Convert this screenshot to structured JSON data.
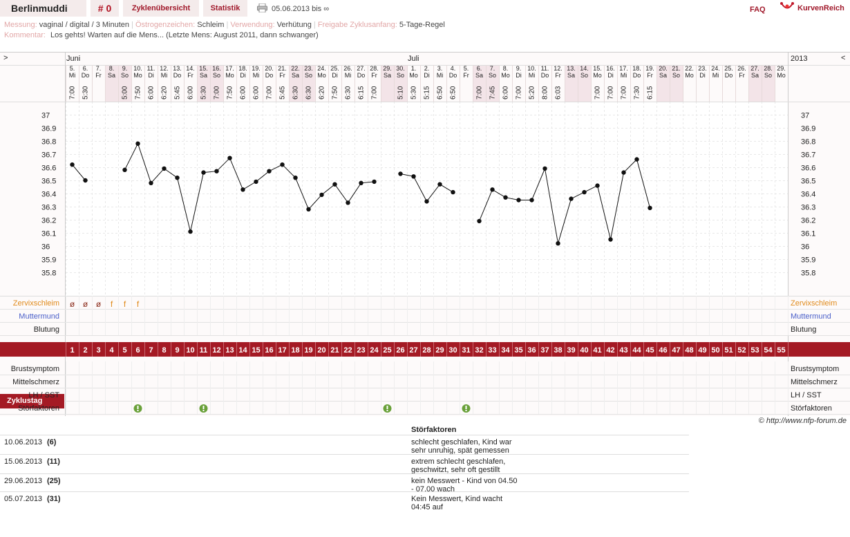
{
  "header": {
    "username": "Berlinmuddi",
    "cycle_number": "# 0",
    "tabs": [
      "Zyklenübersicht",
      "Statistik"
    ],
    "date_range": "05.06.2013 bis ∞",
    "faq": "FAQ",
    "brand": "KurvenReich"
  },
  "info": {
    "messung_label": "Messung:",
    "messung_value": "vaginal / digital / 3 Minuten",
    "oestrogen_label": "Östrogenzeichen:",
    "oestrogen_value": "Schleim",
    "verwendung_label": "Verwendung:",
    "verwendung_value": "Verhütung",
    "freigabe_label": "Freigabe Zyklusanfang:",
    "freigabe_value": "5-Tage-Regel",
    "kommentar_label": "Kommentar:",
    "kommentar_value": "Los gehts! Warten auf die Mens...  (Letzte Mens: August 2011, dann schwanger)"
  },
  "chart_nav": {
    "left_arrow": ">",
    "right_arrow": "<",
    "year": "2013"
  },
  "months": [
    {
      "day_index": 0,
      "label": "Juni"
    },
    {
      "day_index": 26,
      "label": "Juli"
    }
  ],
  "days": [
    {
      "d": "5.",
      "w": "Mi",
      "t": "7:00"
    },
    {
      "d": "6.",
      "w": "Do",
      "t": "5:30"
    },
    {
      "d": "7.",
      "w": "Fr",
      "t": ""
    },
    {
      "d": "8.",
      "w": "Sa",
      "t": ""
    },
    {
      "d": "9.",
      "w": "So",
      "t": "5:00"
    },
    {
      "d": "10.",
      "w": "Mo",
      "t": "7:50"
    },
    {
      "d": "11.",
      "w": "Di",
      "t": "6:00"
    },
    {
      "d": "12.",
      "w": "Mi",
      "t": "6:20"
    },
    {
      "d": "13.",
      "w": "Do",
      "t": "5:45"
    },
    {
      "d": "14.",
      "w": "Fr",
      "t": "6:00"
    },
    {
      "d": "15.",
      "w": "Sa",
      "t": "5:30"
    },
    {
      "d": "16.",
      "w": "So",
      "t": "7:00"
    },
    {
      "d": "17.",
      "w": "Mo",
      "t": "7:50"
    },
    {
      "d": "18.",
      "w": "Di",
      "t": "6:00"
    },
    {
      "d": "19.",
      "w": "Mi",
      "t": "6:00"
    },
    {
      "d": "20.",
      "w": "Do",
      "t": "7:00"
    },
    {
      "d": "21.",
      "w": "Fr",
      "t": "5:45"
    },
    {
      "d": "22.",
      "w": "Sa",
      "t": "6:30"
    },
    {
      "d": "23.",
      "w": "So",
      "t": "6:30"
    },
    {
      "d": "24.",
      "w": "Mo",
      "t": "6:20"
    },
    {
      "d": "25.",
      "w": "Di",
      "t": "7:50"
    },
    {
      "d": "26.",
      "w": "Mi",
      "t": "6:30"
    },
    {
      "d": "27.",
      "w": "Do",
      "t": "6:15"
    },
    {
      "d": "28.",
      "w": "Fr",
      "t": "7:00"
    },
    {
      "d": "29.",
      "w": "Sa",
      "t": ""
    },
    {
      "d": "30.",
      "w": "So",
      "t": "5:10"
    },
    {
      "d": "1.",
      "w": "Mo",
      "t": "5:30"
    },
    {
      "d": "2.",
      "w": "Di",
      "t": "5:15"
    },
    {
      "d": "3.",
      "w": "Mi",
      "t": "6:50"
    },
    {
      "d": "4.",
      "w": "Do",
      "t": "6:50"
    },
    {
      "d": "5.",
      "w": "Fr",
      "t": ""
    },
    {
      "d": "6.",
      "w": "Sa",
      "t": "7:00"
    },
    {
      "d": "7.",
      "w": "So",
      "t": "7:45"
    },
    {
      "d": "8.",
      "w": "Mo",
      "t": "6:00"
    },
    {
      "d": "9.",
      "w": "Di",
      "t": "7:00"
    },
    {
      "d": "10.",
      "w": "Mi",
      "t": "5:20"
    },
    {
      "d": "11.",
      "w": "Do",
      "t": "8:00"
    },
    {
      "d": "12.",
      "w": "Fr",
      "t": "6:03"
    },
    {
      "d": "13.",
      "w": "Sa",
      "t": ""
    },
    {
      "d": "14.",
      "w": "So",
      "t": ""
    },
    {
      "d": "15.",
      "w": "Mo",
      "t": "7:00"
    },
    {
      "d": "16.",
      "w": "Di",
      "t": "7:00"
    },
    {
      "d": "17.",
      "w": "Mi",
      "t": "7:00"
    },
    {
      "d": "18.",
      "w": "Do",
      "t": "7:30"
    },
    {
      "d": "19.",
      "w": "Fr",
      "t": "6:15"
    },
    {
      "d": "20.",
      "w": "Sa",
      "t": ""
    },
    {
      "d": "21.",
      "w": "So",
      "t": ""
    },
    {
      "d": "22.",
      "w": "Mo",
      "t": ""
    },
    {
      "d": "23.",
      "w": "Di",
      "t": ""
    },
    {
      "d": "24.",
      "w": "Mi",
      "t": ""
    },
    {
      "d": "25.",
      "w": "Do",
      "t": ""
    },
    {
      "d": "26.",
      "w": "Fr",
      "t": ""
    },
    {
      "d": "27.",
      "w": "Sa",
      "t": ""
    },
    {
      "d": "28.",
      "w": "So",
      "t": ""
    },
    {
      "d": "29.",
      "w": "Mo",
      "t": ""
    }
  ],
  "chart_data": {
    "type": "line",
    "xlabel": "Zyklustag",
    "ylabel": "",
    "ylim": [
      35.8,
      37.0
    ],
    "y_ticks": [
      "37",
      "36.9",
      "36.8",
      "36.7",
      "36.6",
      "36.5",
      "36.4",
      "36.3",
      "36.2",
      "36.1",
      "36",
      "35.9",
      "35.8"
    ],
    "x": [
      1,
      2,
      3,
      4,
      5,
      6,
      7,
      8,
      9,
      10,
      11,
      12,
      13,
      14,
      15,
      16,
      17,
      18,
      19,
      20,
      21,
      22,
      23,
      24,
      25,
      26,
      27,
      28,
      29,
      30,
      31,
      32,
      33,
      34,
      35,
      36,
      37,
      38,
      39,
      40,
      41,
      42,
      43,
      44,
      45,
      46,
      47,
      48,
      49,
      50,
      51,
      52,
      53,
      54,
      55
    ],
    "series": [
      {
        "values": [
          36.62,
          36.5,
          null,
          null,
          36.58,
          36.78,
          36.48,
          36.59,
          36.52,
          36.11,
          36.56,
          36.57,
          36.67,
          36.43,
          36.49,
          36.57,
          36.62,
          36.52,
          36.28,
          36.39,
          36.47,
          36.33,
          36.48,
          36.49,
          null,
          36.55,
          36.53,
          36.34,
          36.47,
          36.41,
          null,
          36.19,
          36.43,
          36.37,
          36.35,
          36.35,
          36.59,
          36.02,
          36.36,
          36.41,
          36.46,
          36.05,
          36.56,
          36.66,
          36.29,
          null,
          null,
          null,
          null,
          null,
          null,
          null,
          null,
          null,
          null
        ]
      }
    ],
    "grid": true
  },
  "zervix": [
    "ø",
    "ø",
    "ø",
    "f",
    "f",
    "f"
  ],
  "row_labels": {
    "zervix": "Zervixschleim",
    "muttermund": "Muttermund",
    "blutung": "Blutung",
    "zyklustag": "Zyklustag",
    "brust": "Brustsymptom",
    "mittel": "Mittelschmerz",
    "lh": "LH / SST",
    "stoer": "Störfaktoren"
  },
  "stoer_days": [
    6,
    11,
    25,
    31
  ],
  "copyright": "© http://www.nfp-forum.de",
  "stoer_table": {
    "heading": "Störfaktoren",
    "rows": [
      {
        "date": "10.06.2013",
        "num": "(6)",
        "text": "schlecht geschlafen, Kind war sehr unruhig, spät gemessen"
      },
      {
        "date": "15.06.2013",
        "num": "(11)",
        "text": "extrem schlecht geschlafen, geschwitzt, sehr oft gestillt"
      },
      {
        "date": "29.06.2013",
        "num": "(25)",
        "text": "kein Messwert - Kind von 04.50 - 07.00 wach"
      },
      {
        "date": "05.07.2013",
        "num": "(31)",
        "text": "Kein Messwert, Kind wacht 04:45 auf"
      }
    ]
  },
  "colors": {
    "accent": "#a41a24",
    "weekend": "#f3e4e8",
    "zervix_label": "#e08a1a",
    "muttermund_label": "#4a5fc9",
    "stoer_icon": "#6aa13a"
  }
}
